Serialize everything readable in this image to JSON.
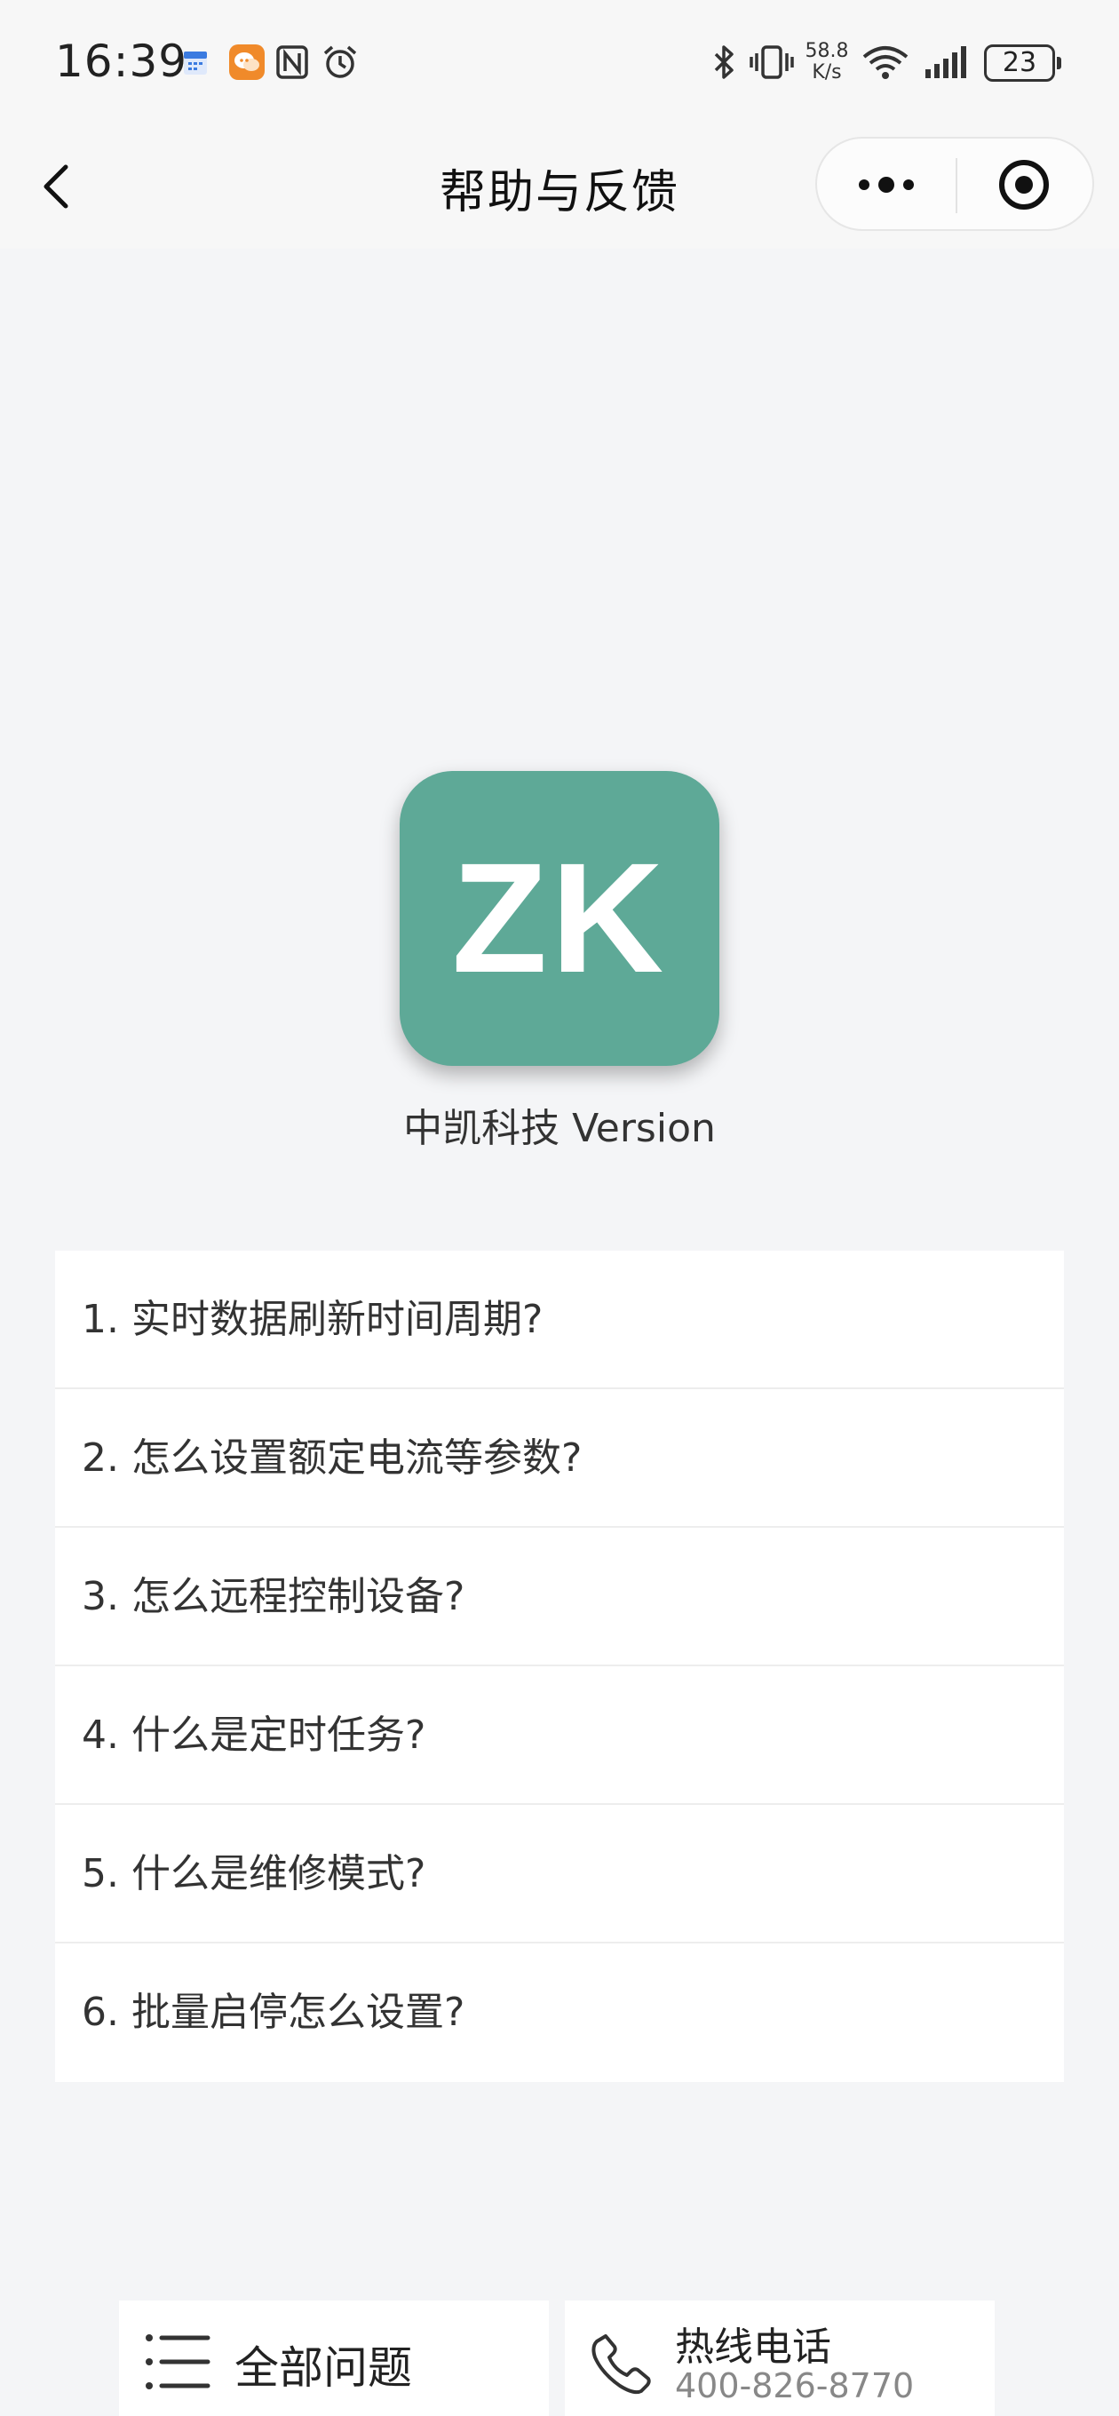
{
  "status_bar": {
    "time": "16:39",
    "net_speed_value": "58.8",
    "net_speed_unit": "K/s",
    "battery": "23",
    "icons": [
      "calendar-icon",
      "chat-app-icon",
      "nfc-icon",
      "alarm-icon",
      "bluetooth-icon",
      "vibrate-icon",
      "wifi-icon",
      "signal-icon",
      "battery-icon"
    ],
    "chat_app_color": "#f08a2a",
    "calendar_color": "#3b7be0"
  },
  "nav": {
    "title": "帮助与反馈",
    "back_icon": "chevron-left-icon",
    "more_icon": "more-dots-icon",
    "close_icon": "target-circle-icon"
  },
  "logo": {
    "text": "ZK",
    "color": "#5ea997"
  },
  "version_label": "中凯科技 Version",
  "faq": [
    {
      "label": "1. 实时数据刷新时间周期?"
    },
    {
      "label": "2. 怎么设置额定电流等参数?"
    },
    {
      "label": "3. 怎么远程控制设备?"
    },
    {
      "label": "4. 什么是定时任务?"
    },
    {
      "label": "5. 什么是维修模式?"
    },
    {
      "label": "6. 批量启停怎么设置?"
    }
  ],
  "bottom": {
    "all_questions_label": "全部问题",
    "hotline_label": "热线电话",
    "hotline_number": "400-826-8770"
  }
}
